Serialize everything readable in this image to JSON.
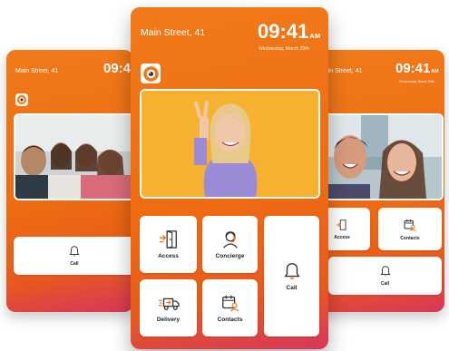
{
  "header": {
    "street": "Main Street, 41",
    "time": "09:41",
    "ampm": "AM",
    "date": "Wednesday, March 29th"
  },
  "tiles": {
    "access": "Access",
    "concierge": "Concierge",
    "call": "Call",
    "delivery": "Delivery",
    "contacts": "Contacts"
  },
  "icons": {
    "logo": "camera-logo-icon",
    "access": "door-access-icon",
    "concierge": "concierge-headset-icon",
    "call": "bell-icon",
    "delivery": "delivery-truck-icon",
    "contacts": "contacts-calendar-icon"
  },
  "colors": {
    "accent": "#ef7215",
    "background_gradient_end": "#d8365a",
    "tile_background": "#ffffff",
    "icon_orange": "#f07a1a"
  }
}
